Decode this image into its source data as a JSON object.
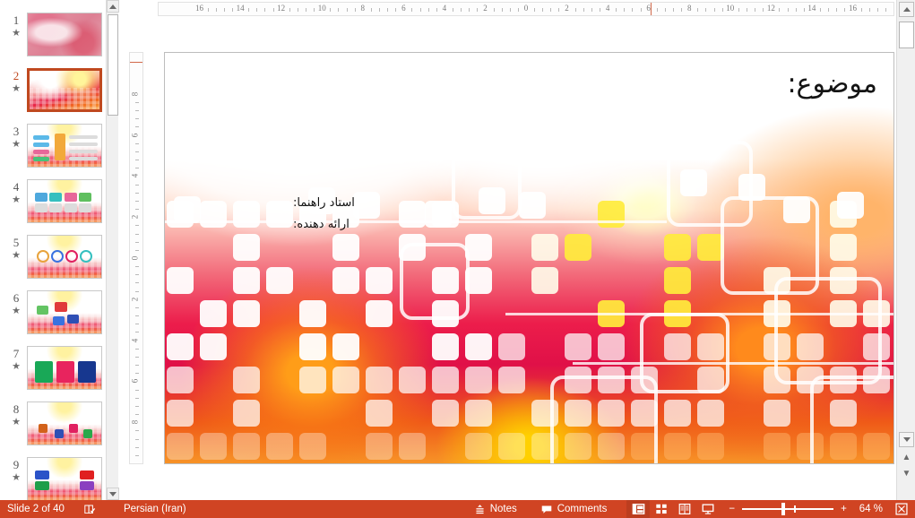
{
  "app": {
    "name": "PowerPoint",
    "view": "Normal"
  },
  "thumbnails": {
    "panel_name": "slide-thumbnail-panel",
    "selected_index": 2,
    "items": [
      {
        "number": "1",
        "star": "★",
        "selected": false
      },
      {
        "number": "2",
        "star": "★",
        "selected": true
      },
      {
        "number": "3",
        "star": "★",
        "selected": false
      },
      {
        "number": "4",
        "star": "★",
        "selected": false
      },
      {
        "number": "5",
        "star": "★",
        "selected": false
      },
      {
        "number": "6",
        "star": "★",
        "selected": false
      },
      {
        "number": "7",
        "star": "★",
        "selected": false
      },
      {
        "number": "8",
        "star": "★",
        "selected": false
      },
      {
        "number": "9",
        "star": "★",
        "selected": false
      }
    ]
  },
  "rulers": {
    "horizontal_labels": [
      "16",
      "14",
      "12",
      "10",
      "8",
      "6",
      "4",
      "2",
      "0",
      "2",
      "4",
      "6",
      "8",
      "10",
      "12",
      "14",
      "16"
    ],
    "vertical_labels": [
      "8",
      "6",
      "4",
      "2",
      "0",
      "2",
      "4",
      "6",
      "8"
    ],
    "units": "cm"
  },
  "slide": {
    "title": "موضوع:",
    "supervisor_label": "استاد راهنما:",
    "presenter_label": "ارائه دهنده:",
    "direction": "rtl"
  },
  "status_bar": {
    "slide_counter": "Slide 2 of 40",
    "proofing_icon": "spell-check-icon",
    "language": "Persian (Iran)",
    "notes_label": "Notes",
    "notes_icon": "notes-icon",
    "comments_label": "Comments",
    "comments_icon": "comment-icon",
    "views": [
      {
        "name": "normal-view",
        "icon": "normal-view-icon",
        "active": true
      },
      {
        "name": "slide-sorter-view",
        "icon": "slide-sorter-icon",
        "active": false
      },
      {
        "name": "reading-view",
        "icon": "reading-view-icon",
        "active": false
      },
      {
        "name": "slide-show-view",
        "icon": "slide-show-icon",
        "active": false
      }
    ],
    "zoom_out_label": "−",
    "zoom_in_label": "+",
    "zoom_value": "64 %",
    "fit_slide_icon": "fit-to-window-icon",
    "accent_color": "#d04423"
  },
  "scrollbars": {
    "thumb_panel": {
      "up_icon": "scroll-up-arrow",
      "down_icon": "scroll-down-arrow"
    },
    "slide_panel": {
      "up_icon": "scroll-up-arrow",
      "down_icon": "scroll-down-arrow",
      "previous_slide_icon": "previous-slide-arrow",
      "next_slide_icon": "next-slide-arrow"
    }
  }
}
